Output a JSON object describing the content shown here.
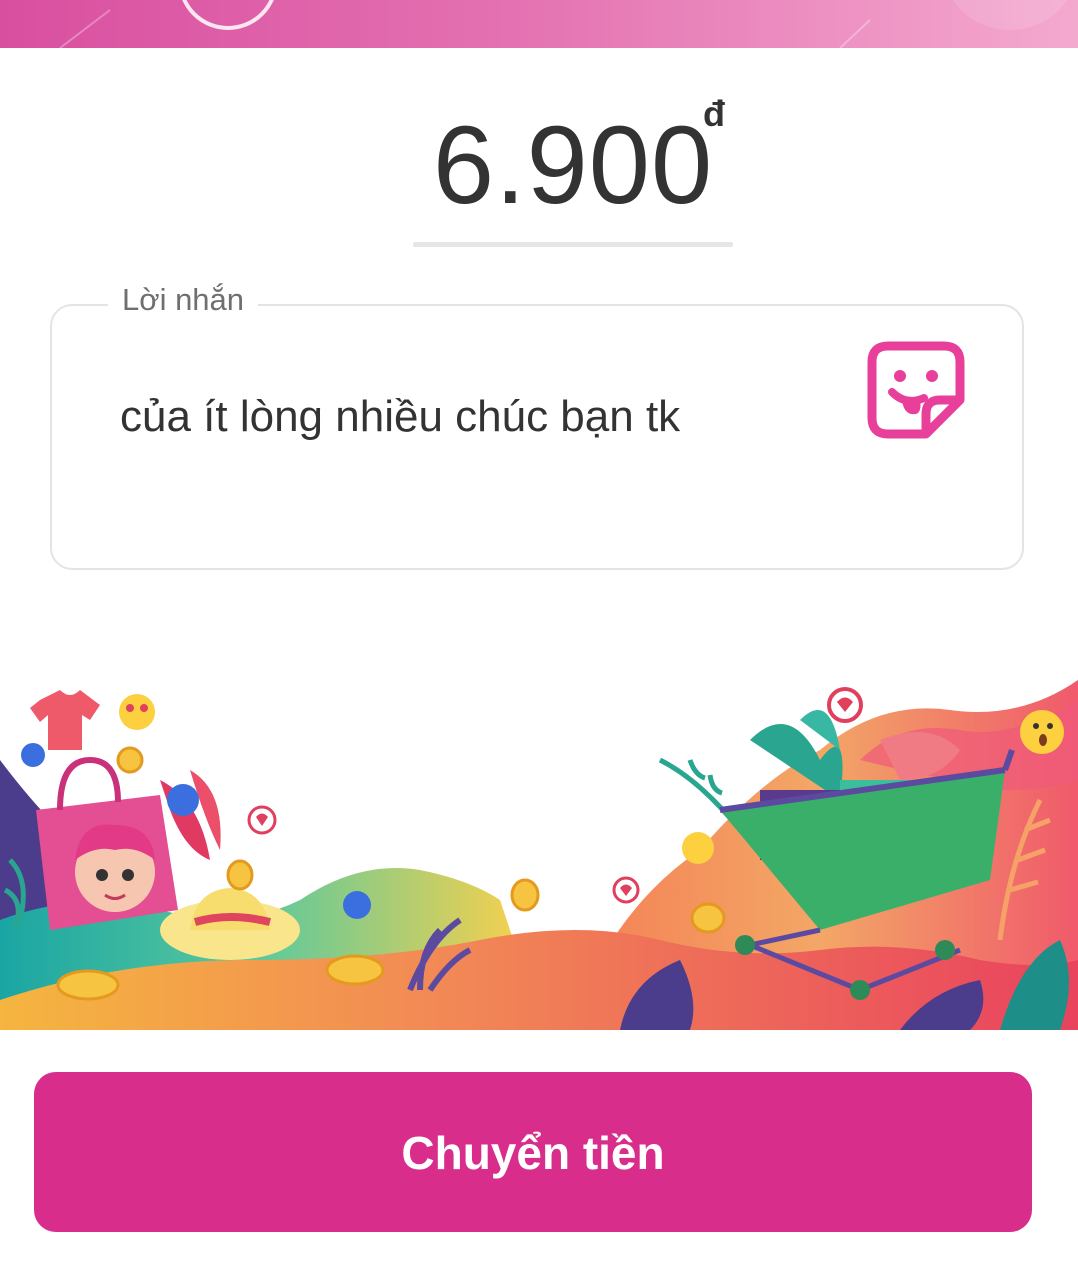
{
  "amount": {
    "value": "6.900",
    "currency": "đ"
  },
  "message": {
    "label": "Lời nhắn",
    "text": "của ít lòng nhiều chúc bạn tk",
    "sticker_icon": "sticker-icon"
  },
  "illustration": {
    "icon": "shopping-illustration"
  },
  "actions": {
    "transfer_label": "Chuyển tiền"
  },
  "colors": {
    "accent": "#d82d8b",
    "sticker": "#e8409a",
    "text": "#333333",
    "banner": "#e36fb0"
  }
}
